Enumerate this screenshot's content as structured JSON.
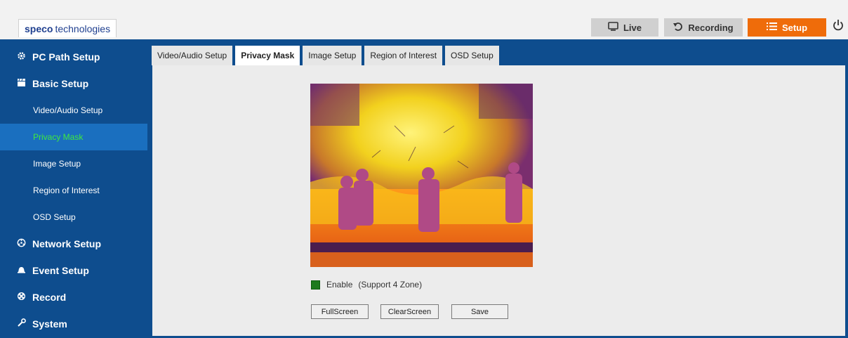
{
  "brand": {
    "bold": "speco",
    "rest": "technologies"
  },
  "top_nav": {
    "live": "Live",
    "recording": "Recording",
    "setup": "Setup",
    "power_icon": "power-icon"
  },
  "sidebar": {
    "items": [
      {
        "label": "PC Path Setup",
        "type": "head",
        "icon": "gear-icon"
      },
      {
        "label": "Basic Setup",
        "type": "head",
        "icon": "clapperboard-icon"
      },
      {
        "label": "Video/Audio Setup",
        "type": "sub"
      },
      {
        "label": "Privacy Mask",
        "type": "sub",
        "active": true
      },
      {
        "label": "Image Setup",
        "type": "sub"
      },
      {
        "label": "Region of Interest",
        "type": "sub"
      },
      {
        "label": "OSD Setup",
        "type": "sub"
      },
      {
        "label": "Network Setup",
        "type": "head",
        "icon": "network-icon"
      },
      {
        "label": "Event Setup",
        "type": "head",
        "icon": "bell-icon"
      },
      {
        "label": "Record",
        "type": "head",
        "icon": "film-reel-icon"
      },
      {
        "label": "System",
        "type": "head",
        "icon": "wrench-icon"
      }
    ]
  },
  "tabs": [
    {
      "label": "Video/Audio Setup"
    },
    {
      "label": "Privacy Mask",
      "active": true
    },
    {
      "label": "Image Setup"
    },
    {
      "label": "Region of Interest"
    },
    {
      "label": "OSD Setup"
    }
  ],
  "privacy_mask": {
    "enable_label": "Enable",
    "support_label": "(Support 4 Zone)",
    "enabled": true,
    "buttons": {
      "fullscreen": "FullScreen",
      "clearscreen": "ClearScreen",
      "save": "Save"
    }
  },
  "colors": {
    "sidebar_bg": "#0e4d8e",
    "active_item_text": "#3ee83e",
    "setup_button": "#ef6c0a",
    "enable_checkbox": "#1e7a1e"
  }
}
